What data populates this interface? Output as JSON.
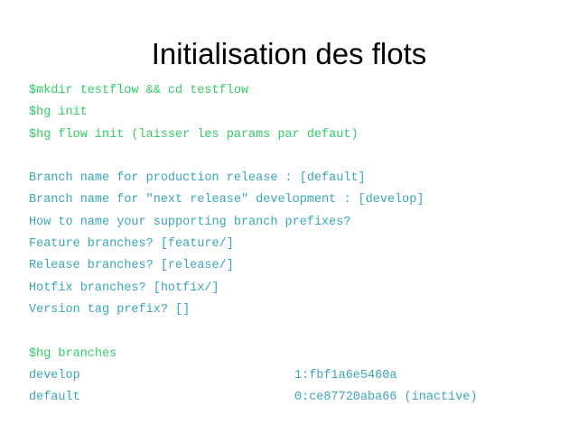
{
  "slide": {
    "title": "Initialisation des flots"
  },
  "colors": {
    "command": "#33cc66",
    "output": "#3aa6b8",
    "title": "#000000",
    "background": "#ffffff"
  },
  "commands": [
    "$mkdir testflow && cd testflow",
    "$hg init",
    "$hg flow init (laisser les params par defaut)"
  ],
  "prompts": [
    "Branch name for production release : [default]",
    "Branch name for \"next release\" development : [develop]",
    "How to name your supporting branch prefixes?",
    "Feature branches? [feature/]",
    "Release branches? [release/]",
    "Hotfix branches? [hotfix/]",
    "Version tag prefix? []"
  ],
  "branches_command": "$hg branches",
  "branches": [
    {
      "name": "develop",
      "rev": "1:fbf1a6e5460a"
    },
    {
      "name": "default",
      "rev": "0:ce87720aba66 (inactive)"
    }
  ]
}
